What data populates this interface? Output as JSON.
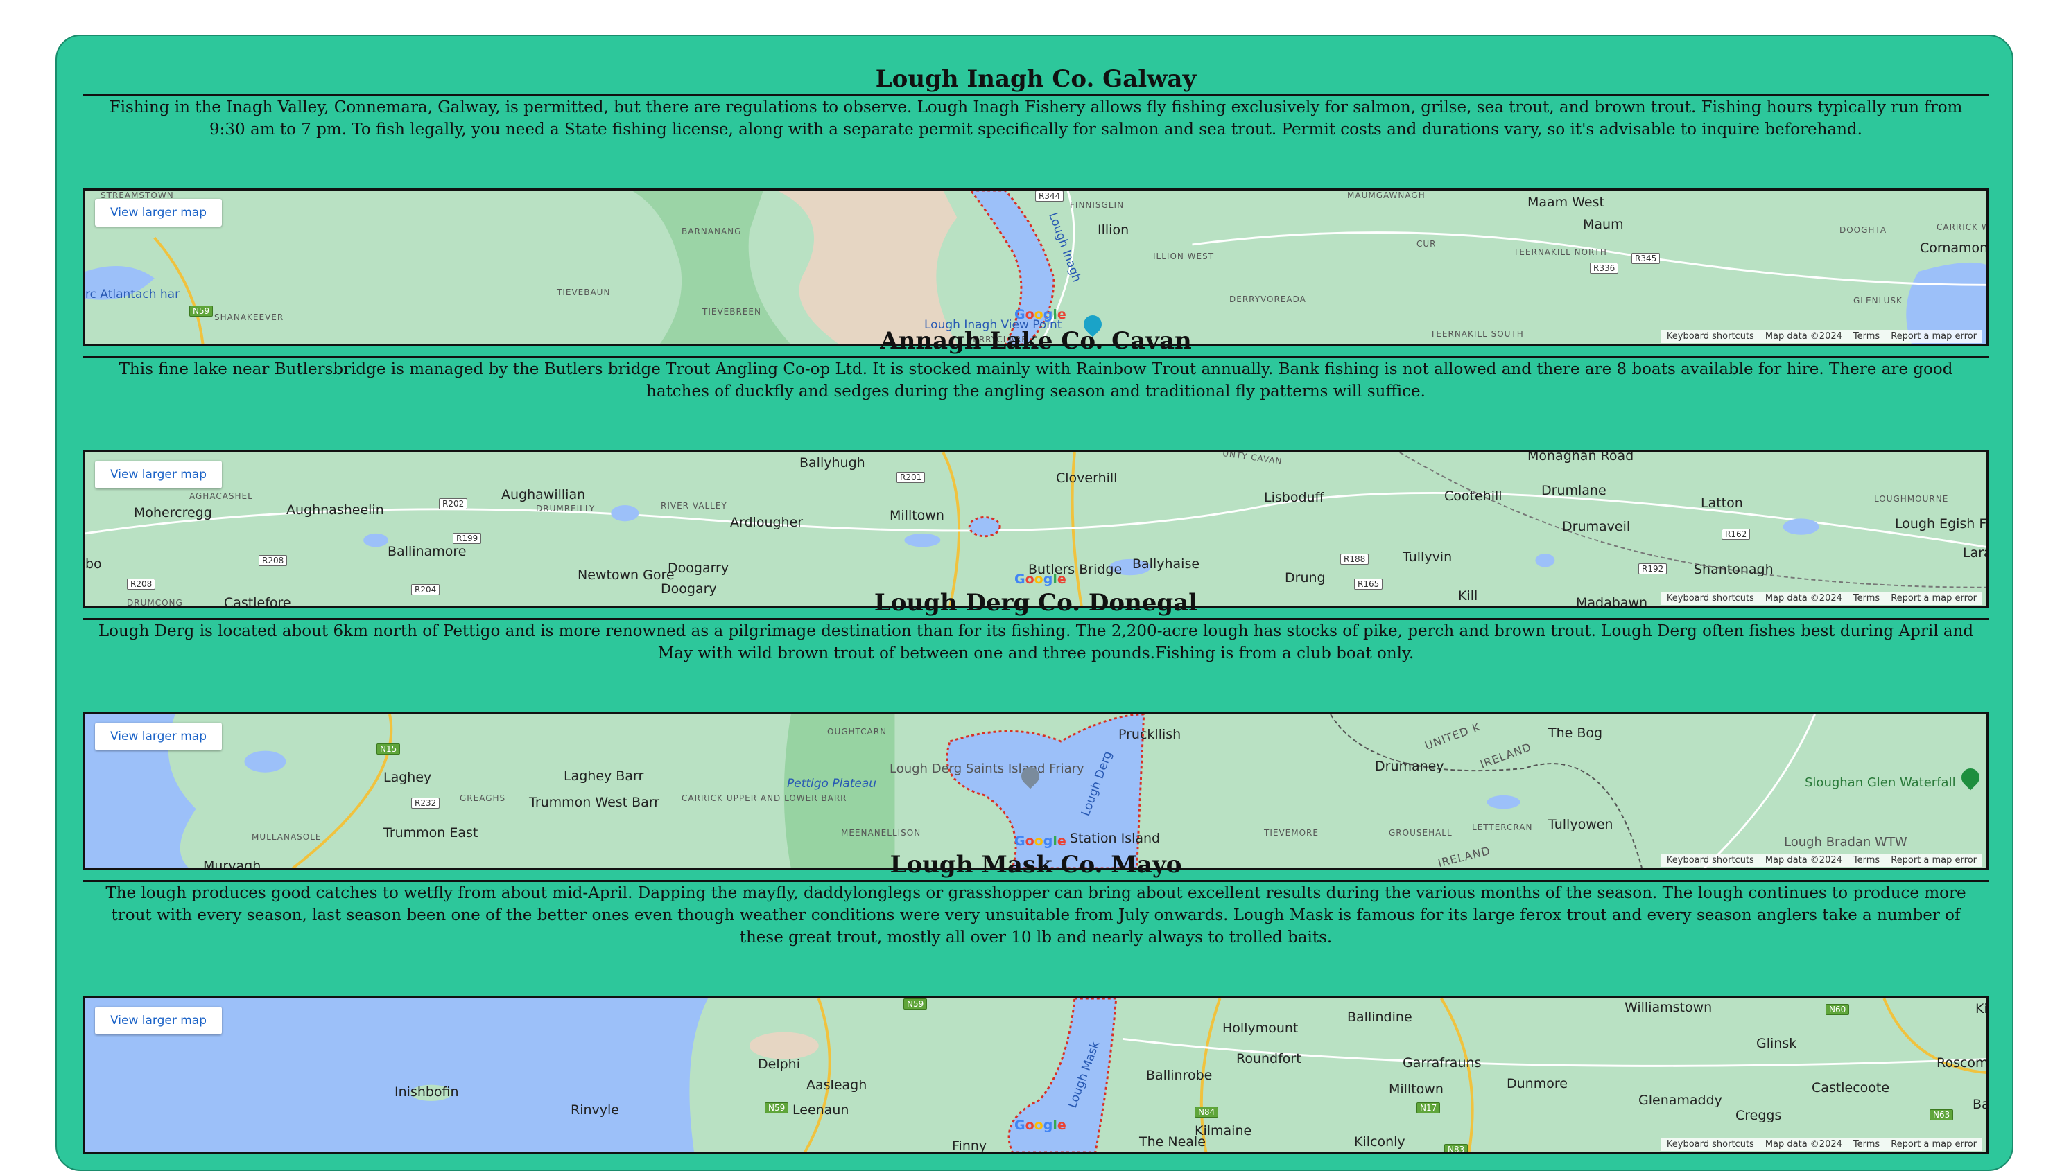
{
  "sections": [
    {
      "title": "Lough Inagh Co. Galway",
      "description": "Fishing in the Inagh Valley, Connemara, Galway, is permitted, but there are regulations to observe. Lough Inagh Fishery allows fly fishing exclusively for salmon, grilse, sea trout, and brown trout. Fishing hours typically run from 9:30 am to 7 pm. To fish legally, you need a State fishing license, along with a separate permit specifically for salmon and sea trout. Permit costs and durations vary, so it's advisable to inquire beforehand.",
      "map": {
        "view_larger": "View larger map",
        "footer": [
          "Keyboard shortcuts",
          "Map data ©2024",
          "Terms",
          "Report a map error"
        ],
        "labels": [
          "STREAMSTOWN",
          "BARNANANG",
          "FINNISGLIN",
          "Illion",
          "MAUMGAWNAGH",
          "Maam West",
          "Maum",
          "DOOGHTA",
          "CARRICK W",
          "Cornamona",
          "CUR",
          "TEERNAKILL NORTH",
          "ILLION WEST",
          "TIEVEBAUN",
          "TIEVEBREEN",
          "DERRYVOREADA",
          "SHANAKEEVER",
          "rc Atlantach har",
          "Lough Inagh View Point",
          "DERRYCLARE",
          "TEERNAKILL SOUTH",
          "GLENLUSK",
          "Lough Inagh"
        ],
        "roads": [
          "R344",
          "R336",
          "R345",
          "N59"
        ]
      }
    },
    {
      "title": "Annagh Lake Co. Cavan",
      "description": "This fine lake near Butlersbridge is managed by the Butlers bridge Trout Angling Co-op Ltd. It is stocked mainly with Rainbow Trout annually. Bank fishing is not allowed and there are 8 boats available for hire. There are good hatches of duckfly and sedges during the angling season and traditional fly patterns will suffice.",
      "map": {
        "view_larger": "View larger map",
        "footer": [
          "Keyboard shortcuts",
          "Map data ©2024",
          "Terms",
          "Report a map error"
        ],
        "labels": [
          "Ballyhugh",
          "Cloverhill",
          "UNTY CAVAN",
          "Monaghan Road",
          "Cootehill",
          "Drumlane",
          "Latton",
          "LOUGHMOURNE",
          "AGHACASHEL",
          "Mohercregg",
          "Aughnasheelin",
          "Aughawillian",
          "DRUMREILLY",
          "RIVER VALLEY",
          "Ardlougher",
          "Milltown",
          "Lisboduff",
          "Drumaveil",
          "Lough Egish Food Park",
          "Laragh",
          "Ballinamore",
          "Newtown Gore",
          "Doogarry",
          "Doogary",
          "Butlers Bridge",
          "Ballyhaise",
          "Drung",
          "Tullyvin",
          "Shantonagh",
          "Kill",
          "Madabawn",
          "DRUMCONG",
          "Castlefore",
          "bo"
        ],
        "roads": [
          "R201",
          "R202",
          "R199",
          "R208",
          "R204",
          "R188",
          "R165",
          "R162",
          "R192",
          "R208"
        ]
      }
    },
    {
      "title": "Lough Derg Co. Donegal",
      "description": "Lough Derg is located about 6km north of Pettigo and is more renowned as a pilgrimage destination than for its fishing. The 2,200-acre lough has stocks of pike, perch and brown trout. Lough Derg often fishes best during April and May with wild brown trout of between one and three pounds.Fishing is from a club boat only.",
      "map": {
        "view_larger": "View larger map",
        "footer": [
          "Keyboard shortcuts",
          "Map data ©2024",
          "Terms",
          "Report a map error"
        ],
        "labels": [
          "OUGHTCARN",
          "Pruckllish",
          "UNITED K",
          "IRELAND",
          "The Bog",
          "Laghey",
          "Laghey Barr",
          "Pettigo Plateau",
          "Lough Derg Saints Island Friary",
          "Drumaney",
          "Sloughan Glen Waterfall",
          "GREAGHS",
          "Trummon West Barr",
          "CARRICK UPPER AND LOWER BARR",
          "MULLANASOLE",
          "Trummon East",
          "MEENANELLISON",
          "Station Island",
          "TIEVEMORE",
          "GROUSEHALL",
          "LETTERCRAN",
          "Tullyowen",
          "Lough Bradan WTW",
          "IRELAND",
          "Muryagh",
          "Lough Derg"
        ],
        "roads": [
          "N15",
          "R232"
        ]
      }
    },
    {
      "title": "Lough Mask Co. Mayo",
      "description": "The lough produces good catches to wetfly from about mid-April. Dapping the mayfly, daddylonglegs or grasshopper can bring about excellent results during the various months of the season. The lough continues to produce more trout with every season, last season been one of the better ones even though weather conditions were very unsuitable from July onwards. Lough Mask is famous for its large ferox trout and every season anglers take a number of these great trout, mostly all over 10 lb and nearly always to trolled baits.",
      "map": {
        "view_larger": "View larger map",
        "footer": [
          "Keyboard shortcuts",
          "Map data ©2024",
          "Terms",
          "Report a map error"
        ],
        "labels": [
          "Hollymount",
          "Ballindine",
          "Williamstown",
          "Delphi",
          "Roundfort",
          "Garrafrauns",
          "Glinsk",
          "Roscommo",
          "Inishbofin",
          "Aasleagh",
          "Ballinrobe",
          "Milltown",
          "Dunmore",
          "Glenamaddy",
          "Castlecoote",
          "Rinvyle",
          "Leenaun",
          "Kilmaine",
          "Creggs",
          "Bally",
          "Finny",
          "The Neale",
          "Kilconly",
          "Lough Mask",
          "Kil"
        ],
        "roads": [
          "N59",
          "N59",
          "N84",
          "N17",
          "N83",
          "N60",
          "N63"
        ]
      }
    }
  ],
  "colors": {
    "card": "#2dc79b",
    "land": "#b9e1c3",
    "water": "#9cc0f9",
    "forest": "#8fcf9a",
    "sand": "#e6d6c3",
    "boundary": "#d93025"
  }
}
